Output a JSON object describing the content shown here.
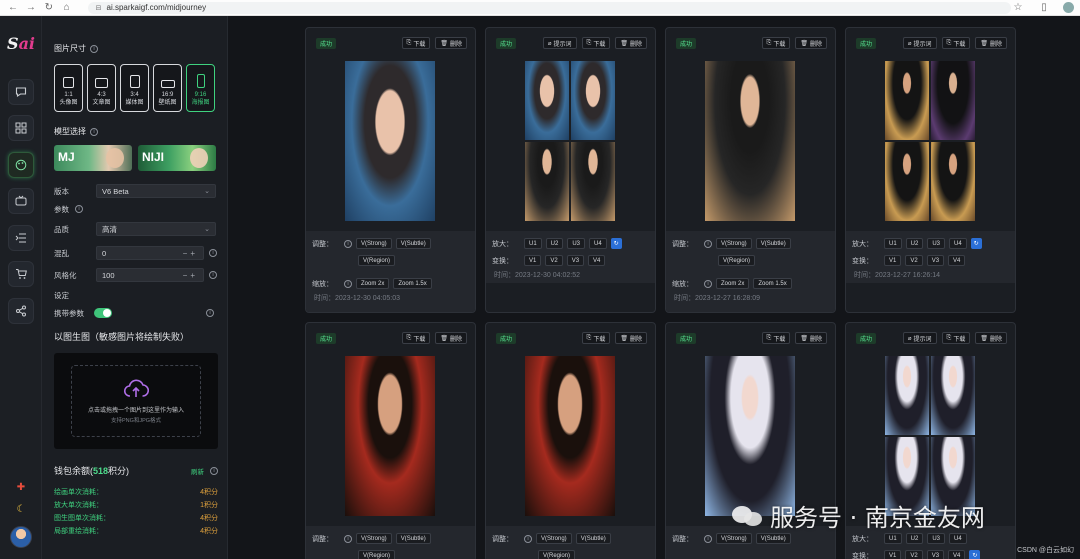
{
  "browser": {
    "url": "ai.sparkaigf.com/midjourney"
  },
  "sidebar": {
    "logo": "Sai"
  },
  "panel": {
    "size_title": "图片尺寸",
    "sizes": [
      {
        "ratio": "1:1",
        "label": "头像图"
      },
      {
        "ratio": "4:3",
        "label": "文章图"
      },
      {
        "ratio": "3:4",
        "label": "媒体图"
      },
      {
        "ratio": "16:9",
        "label": "壁纸图"
      },
      {
        "ratio": "9:16",
        "label": "海报图"
      }
    ],
    "model_title": "模型选择",
    "models": [
      "MJ",
      "NIJI"
    ],
    "version_label": "版本",
    "version_value": "V6 Beta",
    "params_label": "参数",
    "quality_label": "品质",
    "quality_value": "高清",
    "chaos_label": "混乱",
    "chaos_value": "0",
    "stylize_label": "风格化",
    "stylize_value": "100",
    "settings_label": "设定",
    "carry_label": "携带参数",
    "img2img_title": "以图生图（敏感图片将绘制失败）",
    "upload_text": "点击或拖拽一个图片到这里作为输入",
    "upload_sub": "支持PNG和JPG格式",
    "wallet_title_prefix": "钱包余额(",
    "wallet_amount": "518",
    "wallet_title_suffix": "积分)",
    "refresh": "刷新",
    "costs": [
      {
        "label": "绘画单次消耗：",
        "value": "4积分"
      },
      {
        "label": "放大单次消耗：",
        "value": "1积分"
      },
      {
        "label": "图生图单次消耗：",
        "value": "4积分"
      },
      {
        "label": "局部重绘消耗：",
        "value": "4积分"
      }
    ]
  },
  "cards_common": {
    "status": "成功",
    "prompt": "提示词",
    "download": "下载",
    "delete": "删除",
    "adjust": "调整：",
    "zoom": "缩放：",
    "upscale": "放大：",
    "variation": "变换：",
    "v_strong": "V(Strong)",
    "v_subtle": "V(Subtle)",
    "v_region": "V(Region)",
    "zoom_2x": "Zoom 2x",
    "zoom_15x": "Zoom 1.5x",
    "u": [
      "U1",
      "U2",
      "U3",
      "U4"
    ],
    "v": [
      "V1",
      "V2",
      "V3",
      "V4"
    ]
  },
  "cards": [
    {
      "time": "时间：2023-12-30 04:05:03"
    },
    {
      "time": "时间：2023-12-30 04:02:52"
    },
    {
      "time": "时间：2023-12-27 16:28:09"
    },
    {
      "time": "时间：2023-12-27 16:26:14"
    }
  ],
  "watermark": {
    "text": "服务号 · 南京金友网",
    "csdn": "CSDN @白云如幻"
  }
}
